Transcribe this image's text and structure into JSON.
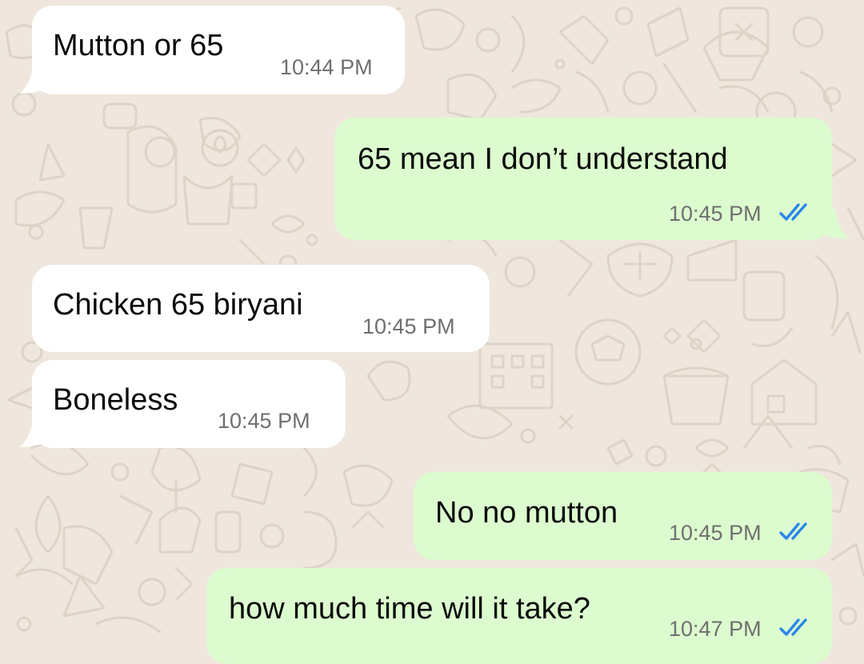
{
  "chat": {
    "messages": [
      {
        "direction": "incoming",
        "text": "Mutton or 65",
        "time": "10:44 PM"
      },
      {
        "direction": "outgoing",
        "text": "65 mean I don’t understand",
        "time": "10:45 PM",
        "status": "read"
      },
      {
        "direction": "incoming",
        "text": "Chicken 65 biryani",
        "time": "10:45 PM"
      },
      {
        "direction": "incoming",
        "text": "Boneless",
        "time": "10:45 PM"
      },
      {
        "direction": "outgoing",
        "text": "No no mutton",
        "time": "10:45 PM",
        "status": "read"
      },
      {
        "direction": "outgoing",
        "text": "how much time will it take?",
        "time": "10:47 PM",
        "status": "read"
      }
    ]
  },
  "colors": {
    "wallpaper": "#efe7dd",
    "incoming_bubble": "#ffffff",
    "outgoing_bubble": "#dcfccf",
    "read_ticks": "#2a86e8",
    "timestamp": "#6f6f6f"
  },
  "icons": {
    "read_receipt": "double-check-icon"
  }
}
